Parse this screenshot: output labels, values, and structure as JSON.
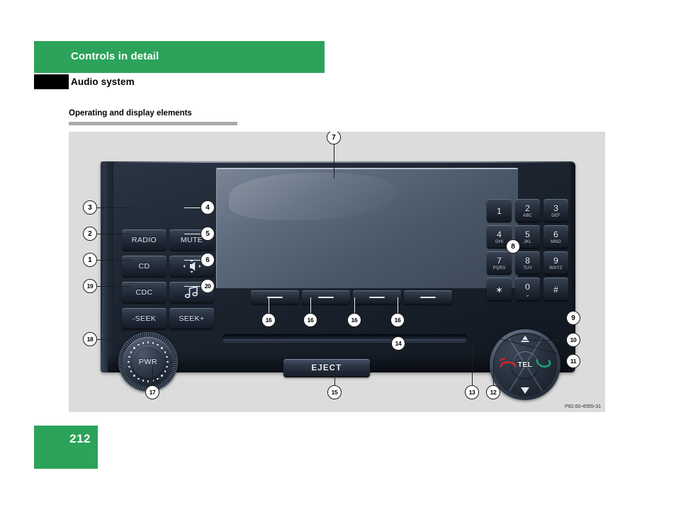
{
  "header": {
    "band_title": "Controls in detail",
    "sub_title": "Audio system",
    "band_color": "#2ba35a"
  },
  "section": {
    "title": "Operating and display elements"
  },
  "figure": {
    "id_label": "P82.60-4555-31",
    "background": "#dcdcdc"
  },
  "unit": {
    "buttons_left": [
      {
        "label": "RADIO",
        "callout": "3"
      },
      {
        "label": "CD",
        "callout": "2"
      },
      {
        "label": "CDC",
        "callout": "1"
      },
      {
        "label": "-SEEK",
        "callout": "19"
      }
    ],
    "buttons_right": [
      {
        "label": "MUTE",
        "callout": "4"
      },
      {
        "label": "",
        "icon": "speaker-balance-icon",
        "callout": "5"
      },
      {
        "label": "",
        "icon": "music-note-icon",
        "callout": "6"
      },
      {
        "label": "SEEK+",
        "callout": "20"
      }
    ],
    "keypad": [
      {
        "digit": "1",
        "letters": ""
      },
      {
        "digit": "2",
        "letters": "ABC"
      },
      {
        "digit": "3",
        "letters": "DEF"
      },
      {
        "digit": "4",
        "letters": "GHI"
      },
      {
        "digit": "5",
        "letters": "JKL"
      },
      {
        "digit": "6",
        "letters": "MNO"
      },
      {
        "digit": "7",
        "letters": "PQRS"
      },
      {
        "digit": "8",
        "letters": "TUV"
      },
      {
        "digit": "9",
        "letters": "WXYZ"
      },
      {
        "digit": "∗",
        "letters": ""
      },
      {
        "digit": "0",
        "letters": "␣"
      },
      {
        "digit": "#",
        "letters": ""
      }
    ],
    "keypad_callout": "8",
    "presets": [
      {
        "callout": "16"
      },
      {
        "callout": "16"
      },
      {
        "callout": "16"
      },
      {
        "callout": "16"
      }
    ],
    "display_callout": "7",
    "cd_slot_callout": "14",
    "eject_label": "EJECT",
    "eject_callout": "15",
    "knob_label": "PWR",
    "knob_callout_left": "18",
    "knob_callout_bottom": "17",
    "telpad": {
      "center_label": "TEL",
      "up_callout": "9",
      "green_phone_callout": "10",
      "center_callout": "11",
      "down_callout": "12",
      "red_phone_callout": "13",
      "green_phone_color": "#16a87a",
      "red_phone_color": "#d8232a"
    }
  },
  "footer": {
    "page_number": "212",
    "page_box_color": "#2ba35a"
  }
}
